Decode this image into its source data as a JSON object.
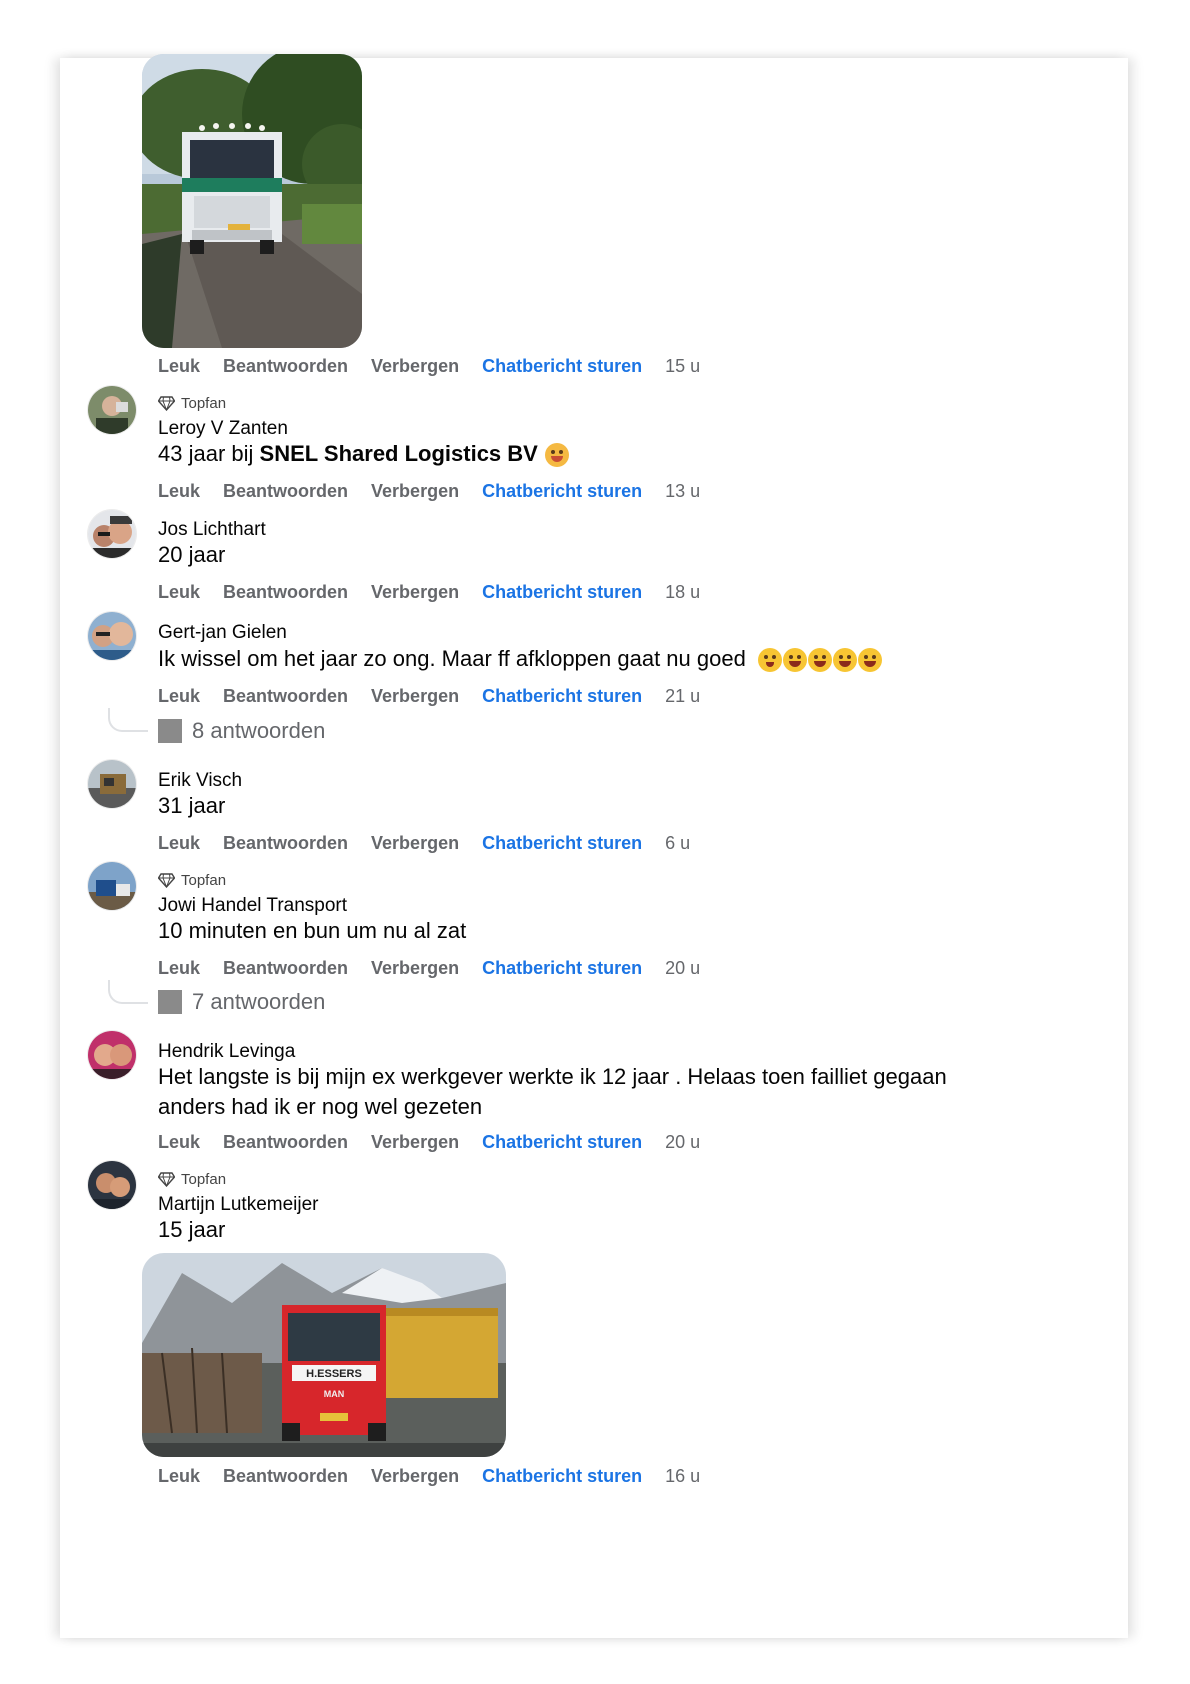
{
  "actions": {
    "like": "Leuk",
    "reply": "Beantwoorden",
    "hide": "Verbergen",
    "chat": "Chatbericht sturen"
  },
  "badge_topfan": "Topfan",
  "comments": [
    {
      "time": "15 u"
    },
    {
      "author": "Leroy V Zanten",
      "text_pre": "43 jaar bij ",
      "text_bold": "SNEL Shared Logistics BV",
      "time": "13 u"
    },
    {
      "author": "Jos Lichthart",
      "text": "20 jaar",
      "time": "18 u"
    },
    {
      "author": "Gert-jan Gielen",
      "text": "Ik wissel om het jaar zo ong. Maar ff afkloppen gaat nu goed",
      "time": "21 u",
      "replies": "8 antwoorden"
    },
    {
      "author": "Erik Visch",
      "text": "31 jaar",
      "time": "6 u"
    },
    {
      "author": "Jowi Handel Transport",
      "text": "10 minuten en bun um nu al zat",
      "time": "20 u",
      "replies": "7 antwoorden"
    },
    {
      "author": "Hendrik Levinga",
      "text_line1": "Het langste is bij mijn ex werkgever werkte ik 12 jaar . Helaas toen failliet gegaan",
      "text_line2": "anders had ik er nog wel gezeten",
      "time": "20 u"
    },
    {
      "author": "Martijn Lutkemeijer",
      "text": "15 jaar",
      "time": "16 u"
    }
  ],
  "photo_truck_2": {
    "cab_text": "H.ESSERS",
    "brand": "MAN"
  },
  "colors": {
    "link_blue": "#1b74e4",
    "muted": "#65676b"
  }
}
